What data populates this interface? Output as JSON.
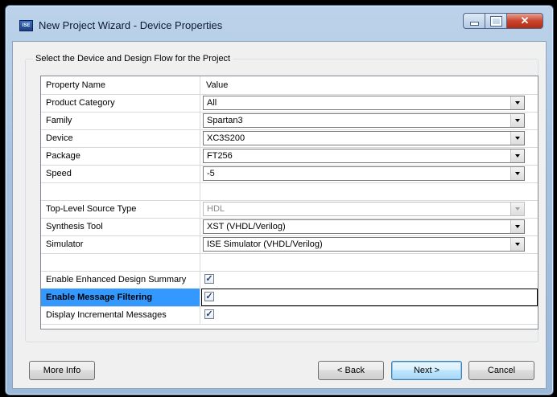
{
  "window": {
    "icon_label": "ISE",
    "title": "New Project Wizard - Device Properties"
  },
  "group": {
    "label": "Select the Device and Design Flow for the Project"
  },
  "grid": {
    "header": {
      "name": "Property Name",
      "value": "Value"
    },
    "rows": [
      {
        "name": "Product Category",
        "value": "All",
        "kind": "combo"
      },
      {
        "name": "Family",
        "value": "Spartan3",
        "kind": "combo"
      },
      {
        "name": "Device",
        "value": "XC3S200",
        "kind": "combo"
      },
      {
        "name": "Package",
        "value": "FT256",
        "kind": "combo"
      },
      {
        "name": "Speed",
        "value": "-5",
        "kind": "combo"
      },
      {
        "name": "Top-Level Source Type",
        "value": "HDL",
        "kind": "combo-disabled"
      },
      {
        "name": "Synthesis Tool",
        "value": "XST (VHDL/Verilog)",
        "kind": "combo"
      },
      {
        "name": "Simulator",
        "value": "ISE Simulator (VHDL/Verilog)",
        "kind": "combo"
      },
      {
        "name": "Enable Enhanced Design Summary",
        "checked": true
      },
      {
        "name": "Enable Message Filtering",
        "checked": true,
        "selected": true
      },
      {
        "name": "Display Incremental Messages",
        "checked": true
      }
    ]
  },
  "buttons": {
    "more_info": "More Info",
    "back": "< Back",
    "next": "Next >",
    "cancel": "Cancel"
  },
  "icons": {
    "close": "close-icon",
    "minimize": "minimize-icon",
    "maximize": "maximize-icon",
    "dropdown": "chevron-down-icon",
    "check": "checkmark-icon"
  }
}
